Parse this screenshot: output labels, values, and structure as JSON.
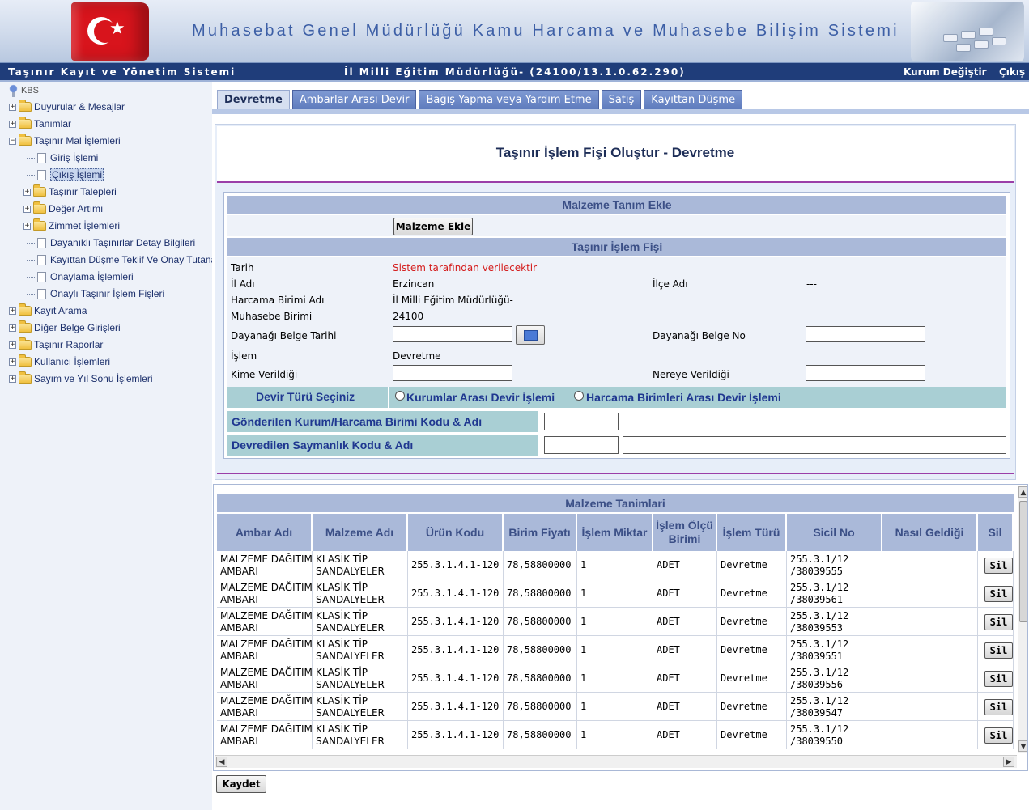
{
  "header": {
    "site_title": "Muhasebat Genel Müdürlüğü Kamu Harcama ve Muhasebe Bilişim Sistemi"
  },
  "navbar": {
    "system_name": "Taşınır Kayıt ve Yönetim Sistemi",
    "unit": "İl Milli Eğitim Müdürlüğü- (24100/13.1.0.62.290)",
    "change_org": "Kurum Değiştir",
    "exit": "Çıkış"
  },
  "sidebar": {
    "root": "KBS",
    "items": [
      {
        "label": "Duyurular & Mesajlar"
      },
      {
        "label": "Tanımlar"
      },
      {
        "label": "Taşınır Mal İşlemleri"
      },
      {
        "label": "Giriş İşlemi"
      },
      {
        "label": "Çıkış İşlemi"
      },
      {
        "label": "Taşınır Talepleri"
      },
      {
        "label": "Değer Artımı"
      },
      {
        "label": "Zimmet İşlemleri"
      },
      {
        "label": "Dayanıklı Taşınırlar Detay Bilgileri"
      },
      {
        "label": "Kayıttan Düşme Teklif Ve Onay Tutanağı"
      },
      {
        "label": "Onaylama İşlemleri"
      },
      {
        "label": "Onaylı Taşınır İşlem Fişleri"
      },
      {
        "label": "Kayıt Arama"
      },
      {
        "label": "Diğer Belge Girişleri"
      },
      {
        "label": "Taşınır Raporlar"
      },
      {
        "label": "Kullanıcı İşlemleri"
      },
      {
        "label": "Sayım ve Yıl Sonu İşlemleri"
      }
    ]
  },
  "tabs": [
    {
      "label": "Devretme"
    },
    {
      "label": "Ambarlar Arası Devir"
    },
    {
      "label": "Bağış Yapma veya Yardım Etme"
    },
    {
      "label": "Satış"
    },
    {
      "label": "Kayıttan Düşme"
    }
  ],
  "form": {
    "title": "Taşınır İşlem Fişi Oluştur - Devretme",
    "section_material": "Malzeme Tanım Ekle",
    "add_material_button": "Malzeme Ekle",
    "section_slip": "Taşınır İşlem Fişi",
    "date_label": "Tarih",
    "date_value": "Sistem tarafından verilecektir",
    "province_label": "İl Adı",
    "province_value": "Erzincan",
    "district_label": "İlçe Adı",
    "district_value": "---",
    "spending_unit_label": "Harcama Birimi Adı",
    "spending_unit_value": "İl Milli Eğitim Müdürlüğü-",
    "accounting_unit_label": "Muhasebe Birimi",
    "accounting_unit_value": "24100",
    "doc_date_label": "Dayanağı Belge Tarihi",
    "doc_date_value": "",
    "doc_no_label": "Dayanağı Belge No",
    "doc_no_value": "",
    "operation_label": "İşlem",
    "operation_value": "Devretme",
    "given_to_label": "Kime Verildiği",
    "given_to_value": "",
    "where_given_label": "Nereye Verildiği",
    "where_given_value": "",
    "transfer_type_label": "Devir Türü Seçiniz",
    "transfer_option_1": "Kurumlar Arası Devir İşlemi",
    "transfer_option_2": "Harcama Birimleri Arası Devir İşlemi",
    "sent_unit_label": "Gönderilen Kurum/Harcama Birimi Kodu & Adı",
    "transferred_acc_label": "Devredilen Saymanlık Kodu & Adı"
  },
  "grid": {
    "title": "Malzeme Tanimlari",
    "columns": [
      "Ambar Adı",
      "Malzeme Adı",
      "Ürün Kodu",
      "Birim Fiyatı",
      "İşlem Miktar",
      "İşlem Ölçü\nBirimi",
      "İşlem Türü",
      "Sicil No",
      "Nasıl Geldiği",
      "Sil"
    ],
    "delete_label": "Sil",
    "rows": [
      {
        "ambar": "MALZEME DAĞITIM\nAMBARI",
        "malzeme": "KLASİK TİP\nSANDALYELER",
        "urun_kodu": "255.3.1.4.1-120",
        "birim_fiyat": "78,58800000",
        "miktar": "1",
        "olcu": "ADET",
        "tur": "Devretme",
        "sicil": "255.3.1/12\n/38039555",
        "nasil": ""
      },
      {
        "ambar": "MALZEME DAĞITIM\nAMBARI",
        "malzeme": "KLASİK TİP\nSANDALYELER",
        "urun_kodu": "255.3.1.4.1-120",
        "birim_fiyat": "78,58800000",
        "miktar": "1",
        "olcu": "ADET",
        "tur": "Devretme",
        "sicil": "255.3.1/12\n/38039561",
        "nasil": ""
      },
      {
        "ambar": "MALZEME DAĞITIM\nAMBARI",
        "malzeme": "KLASİK TİP\nSANDALYELER",
        "urun_kodu": "255.3.1.4.1-120",
        "birim_fiyat": "78,58800000",
        "miktar": "1",
        "olcu": "ADET",
        "tur": "Devretme",
        "sicil": "255.3.1/12\n/38039553",
        "nasil": ""
      },
      {
        "ambar": "MALZEME DAĞITIM\nAMBARI",
        "malzeme": "KLASİK TİP\nSANDALYELER",
        "urun_kodu": "255.3.1.4.1-120",
        "birim_fiyat": "78,58800000",
        "miktar": "1",
        "olcu": "ADET",
        "tur": "Devretme",
        "sicil": "255.3.1/12\n/38039551",
        "nasil": ""
      },
      {
        "ambar": "MALZEME DAĞITIM\nAMBARI",
        "malzeme": "KLASİK TİP\nSANDALYELER",
        "urun_kodu": "255.3.1.4.1-120",
        "birim_fiyat": "78,58800000",
        "miktar": "1",
        "olcu": "ADET",
        "tur": "Devretme",
        "sicil": "255.3.1/12\n/38039556",
        "nasil": ""
      },
      {
        "ambar": "MALZEME DAĞITIM\nAMBARI",
        "malzeme": "KLASİK TİP\nSANDALYELER",
        "urun_kodu": "255.3.1.4.1-120",
        "birim_fiyat": "78,58800000",
        "miktar": "1",
        "olcu": "ADET",
        "tur": "Devretme",
        "sicil": "255.3.1/12\n/38039547",
        "nasil": ""
      },
      {
        "ambar": "MALZEME DAĞITIM\nAMBARI",
        "malzeme": "KLASİK TİP\nSANDALYELER",
        "urun_kodu": "255.3.1.4.1-120",
        "birim_fiyat": "78,58800000",
        "miktar": "1",
        "olcu": "ADET",
        "tur": "Devretme",
        "sicil": "255.3.1/12\n/38039550",
        "nasil": ""
      }
    ]
  },
  "save_button": "Kaydet"
}
